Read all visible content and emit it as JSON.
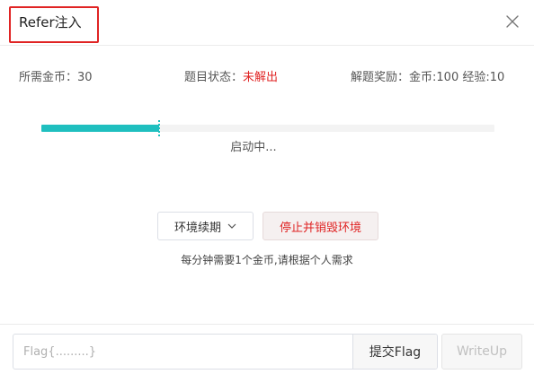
{
  "modal": {
    "title": "Refer注入",
    "close_icon": "close-icon"
  },
  "info": {
    "cost_label": "所需金币：",
    "cost_value": "30",
    "status_label": "题目状态：",
    "status_value": "未解出",
    "reward_label": "解题奖励：",
    "reward_value": "金币:100 经验:10"
  },
  "progress": {
    "percent": 26,
    "status_text": "启动中..."
  },
  "actions": {
    "renew_label": "环境续期",
    "renew_icon": "chevron-down-icon",
    "stop_label": "停止并销毁环境",
    "hint": "每分钟需要1个金币,请根据个人需求"
  },
  "footer": {
    "flag_placeholder": "Flag{.........}",
    "flag_value": "",
    "submit_label": "提交Flag",
    "writeup_label": "WriteUp"
  },
  "colors": {
    "accent": "#1fbfbf",
    "danger": "#e02424"
  }
}
